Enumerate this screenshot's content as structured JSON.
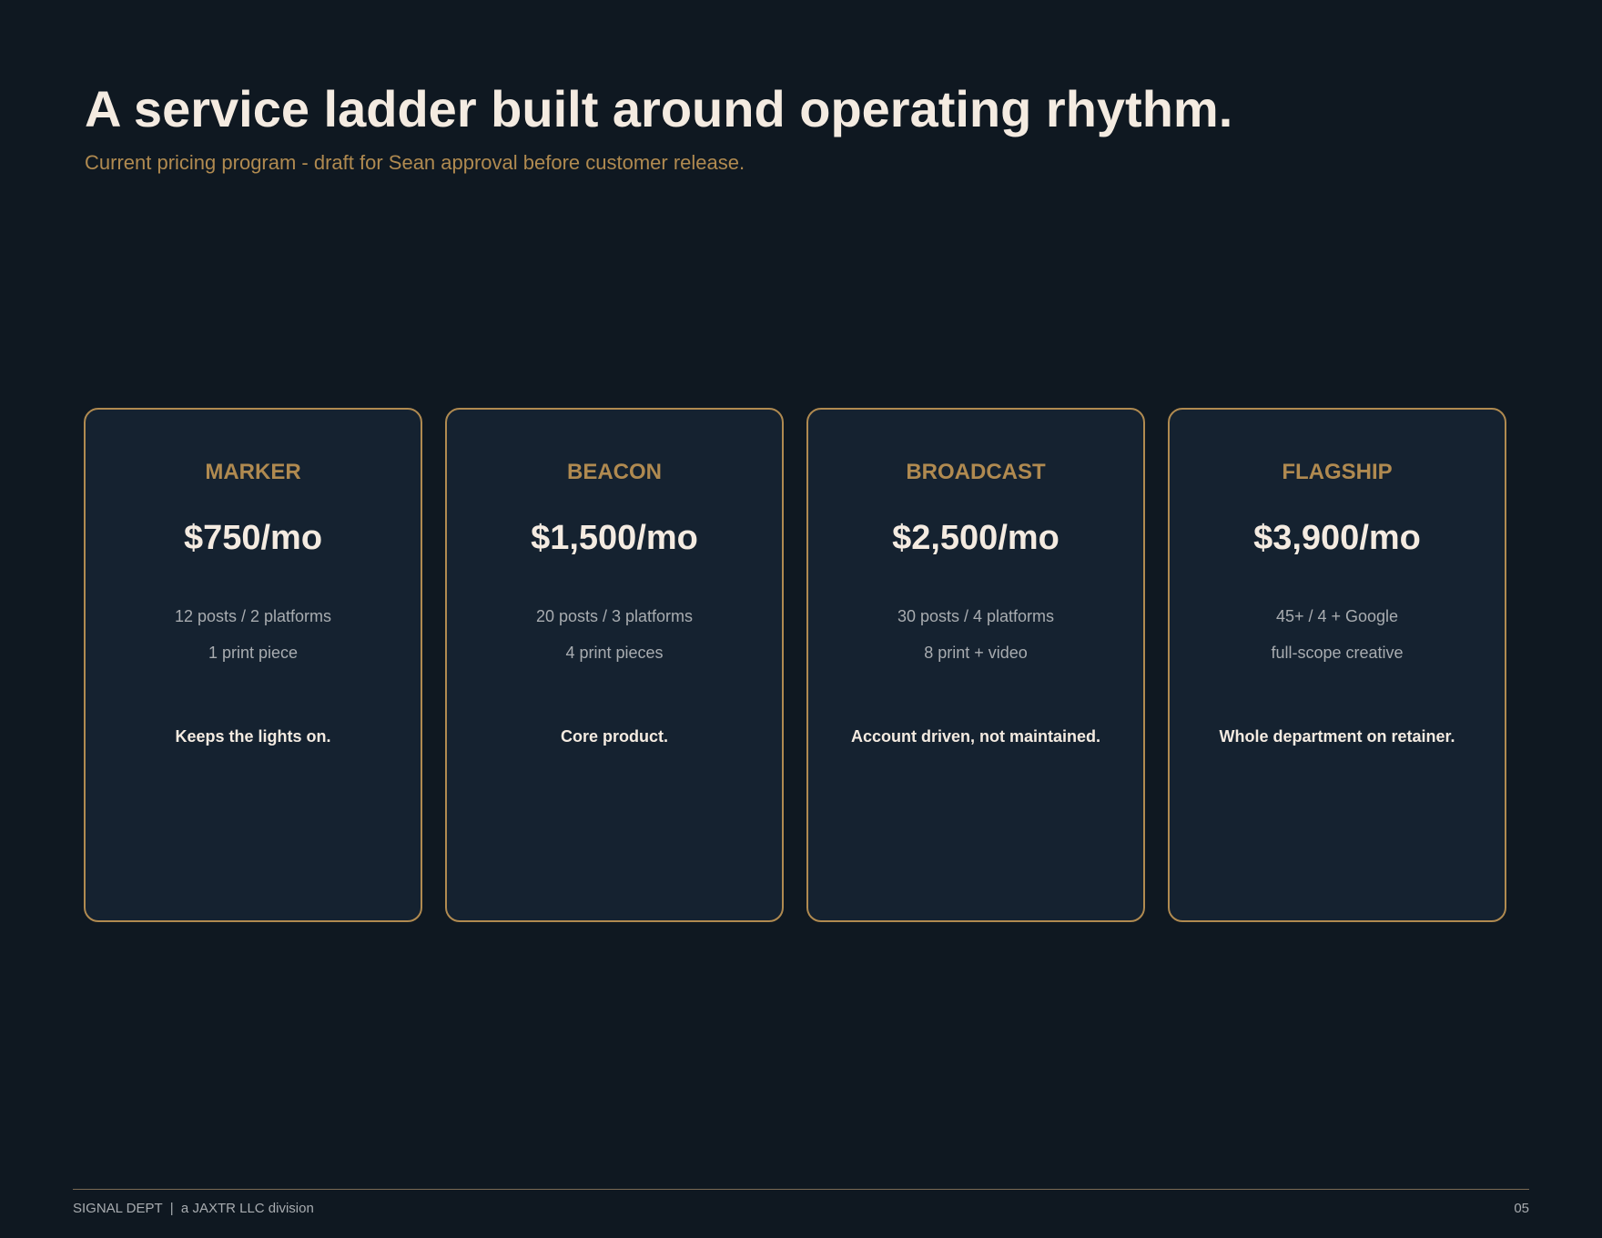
{
  "header": {
    "title": "A service ladder built around operating rhythm.",
    "subtitle": "Current pricing program - draft for Sean approval before customer release."
  },
  "tiers": [
    {
      "name": "MARKER",
      "price": "$750/mo",
      "features": [
        "12 posts / 2 platforms",
        "1 print piece"
      ],
      "tagline": "Keeps the lights on."
    },
    {
      "name": "BEACON",
      "price": "$1,500/mo",
      "features": [
        "20 posts / 3 platforms",
        "4 print pieces"
      ],
      "tagline": "Core product."
    },
    {
      "name": "BROADCAST",
      "price": "$2,500/mo",
      "features": [
        "30 posts / 4 platforms",
        "8 print + video"
      ],
      "tagline": "Account driven, not maintained."
    },
    {
      "name": "FLAGSHIP",
      "price": "$3,900/mo",
      "features": [
        "45+ / 4 + Google",
        "full-scope creative"
      ],
      "tagline": "Whole department on retainer."
    }
  ],
  "footer": {
    "brand": "SIGNAL DEPT  |  a JAXTR LLC division",
    "page_number": "05"
  },
  "colors": {
    "background": "#0f1821",
    "card_background": "#152230",
    "accent": "#b08a50",
    "heading": "#f4ebe1",
    "muted": "#a8acb0"
  }
}
